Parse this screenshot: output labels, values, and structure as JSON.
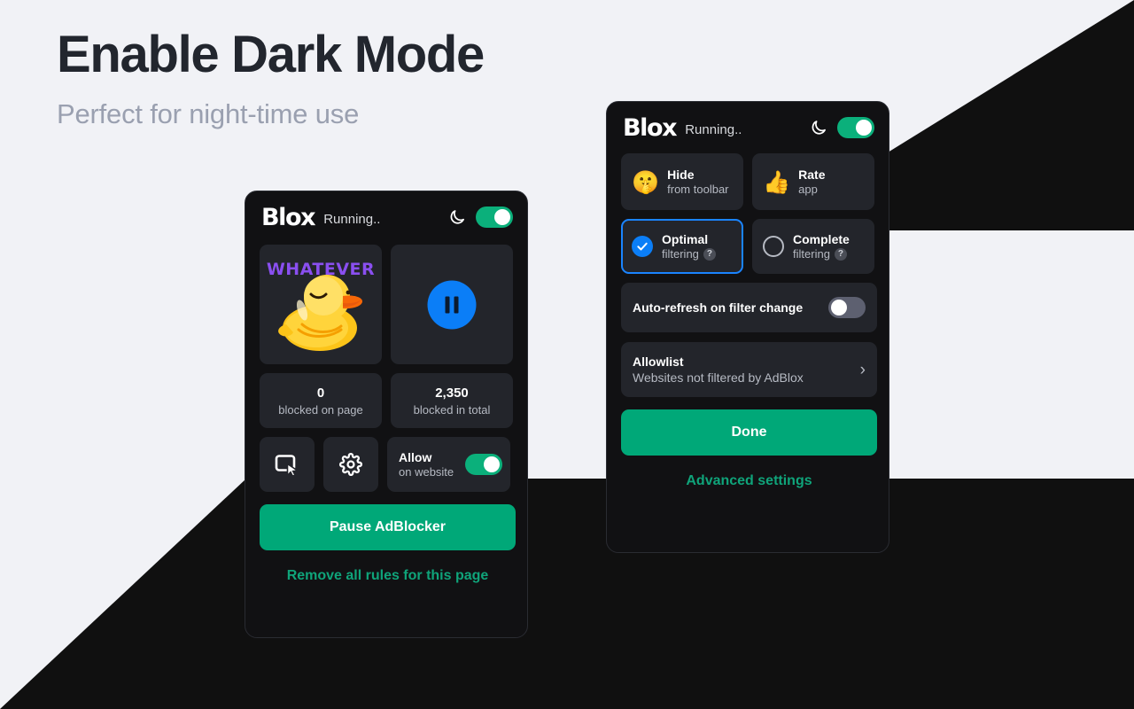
{
  "promo": {
    "headline": "Enable Dark Mode",
    "subhead": "Perfect for night-time use"
  },
  "colors": {
    "page_bg": "#f1f2f6",
    "dark_shape": "#101010",
    "panel_bg": "#111113",
    "tile_bg": "#23252b",
    "accent_green": "#00a878",
    "toggle_on": "#0bb07b",
    "toggle_off": "#5d6070",
    "accent_blue": "#0b7ef7",
    "select_border": "#1a84ff",
    "link_green": "#0fa47a",
    "sticker_purple": "#8a4ff0"
  },
  "popup_main": {
    "header": {
      "logo": "Blox",
      "status": "Running..",
      "moon_icon": "moon-icon",
      "dark_mode_toggle": {
        "state": "on",
        "label": "dark-mode-toggle"
      }
    },
    "sticker": {
      "word": "WHATEVER",
      "icon": "duck-sticker"
    },
    "pause_tile": {
      "icon": "pause-icon"
    },
    "stats": [
      {
        "value": "0",
        "label": "blocked on page"
      },
      {
        "value": "2,350",
        "label": "blocked in total"
      }
    ],
    "actions": {
      "picker_icon": "element-picker-icon",
      "settings_icon": "gear-icon",
      "allow": {
        "title": "Allow",
        "sub": "on website",
        "toggle_state": "on"
      }
    },
    "primary_button": "Pause AdBlocker",
    "link": "Remove all rules for this page"
  },
  "popup_settings": {
    "header": {
      "logo": "Blox",
      "status": "Running..",
      "moon_icon": "moon-icon",
      "dark_mode_toggle": {
        "state": "on",
        "label": "dark-mode-toggle"
      }
    },
    "quick_tiles": [
      {
        "emoji": "🤫",
        "icon": "shush-face-emoji",
        "title": "Hide",
        "sub": "from toolbar"
      },
      {
        "emoji": "👍",
        "icon": "thumbs-up-emoji",
        "title": "Rate",
        "sub": "app"
      }
    ],
    "filter_options": [
      {
        "title": "Optimal",
        "sub": "filtering",
        "selected": true,
        "help": "?"
      },
      {
        "title": "Complete",
        "sub": "filtering",
        "selected": false,
        "help": "?"
      }
    ],
    "auto_refresh": {
      "label": "Auto-refresh on filter change",
      "toggle_state": "off"
    },
    "allowlist": {
      "title": "Allowlist",
      "sub": "Websites not filtered by AdBlox",
      "chevron": "›"
    },
    "done_button": "Done",
    "advanced_link": "Advanced settings"
  }
}
